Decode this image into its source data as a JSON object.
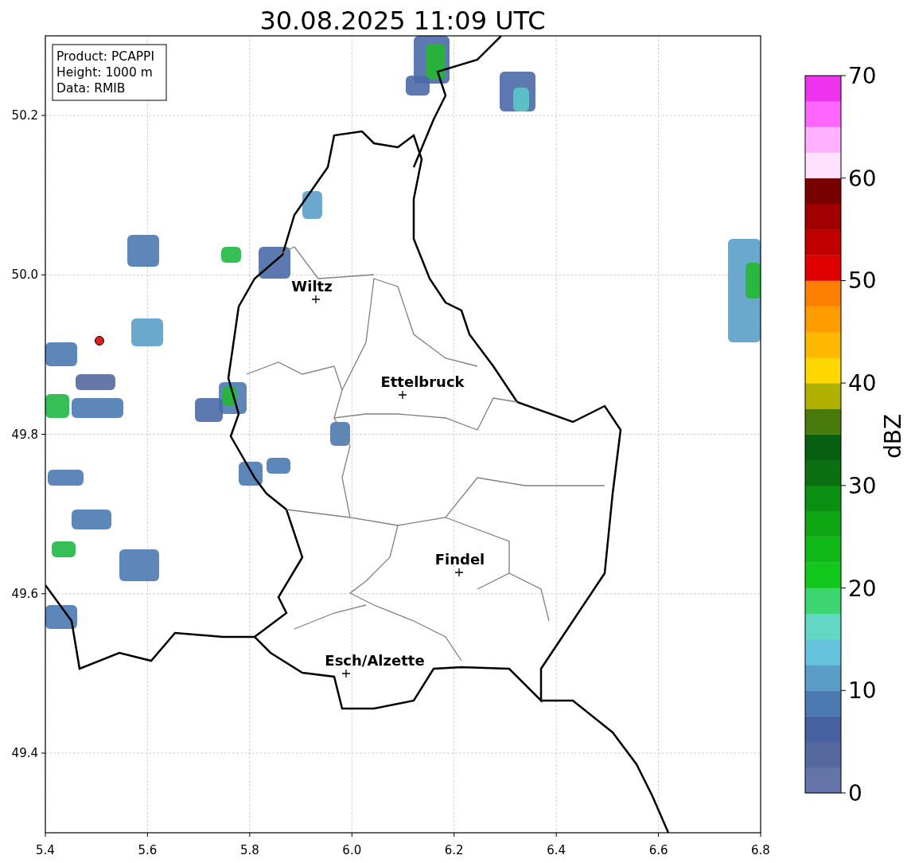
{
  "title": "30.08.2025 11:09 UTC",
  "info_box": [
    "Product: PCAPPI",
    "Height: 1000 m",
    "Data: RMIB"
  ],
  "map": {
    "x_ticks": [
      "5.4",
      "5.6",
      "5.8",
      "6.0",
      "6.2",
      "6.4",
      "6.6",
      "6.8"
    ],
    "y_ticks": [
      "50.2",
      "50.0",
      "49.8",
      "49.6",
      "49.4"
    ],
    "cities": [
      {
        "name": "Wiltz"
      },
      {
        "name": "Ettelbruck"
      },
      {
        "name": "Findel"
      },
      {
        "name": "Esch/Alzette"
      }
    ]
  },
  "colorbar": {
    "label": "dBZ",
    "ticks": [
      "70",
      "60",
      "50",
      "40",
      "30",
      "20",
      "10",
      "0"
    ],
    "segments": [
      {
        "color": "#6574a8"
      },
      {
        "color": "#55699f"
      },
      {
        "color": "#4660a0"
      },
      {
        "color": "#4a7ab0"
      },
      {
        "color": "#5a9ec8"
      },
      {
        "color": "#66c3de"
      },
      {
        "color": "#62d8c4"
      },
      {
        "color": "#3dd572"
      },
      {
        "color": "#12c81c"
      },
      {
        "color": "#10b818"
      },
      {
        "color": "#0fa614"
      },
      {
        "color": "#0b8f12"
      },
      {
        "color": "#0a7011"
      },
      {
        "color": "#066010"
      },
      {
        "color": "#477a0a"
      },
      {
        "color": "#b0b000"
      },
      {
        "color": "#ffd700"
      },
      {
        "color": "#ffb800"
      },
      {
        "color": "#ff9c00"
      },
      {
        "color": "#ff8000"
      },
      {
        "color": "#e00000"
      },
      {
        "color": "#c00000"
      },
      {
        "color": "#a00000"
      },
      {
        "color": "#780000"
      },
      {
        "color": "#ffe0ff"
      },
      {
        "color": "#ffb0ff"
      },
      {
        "color": "#ff66ff"
      },
      {
        "color": "#ee33ee"
      }
    ]
  }
}
